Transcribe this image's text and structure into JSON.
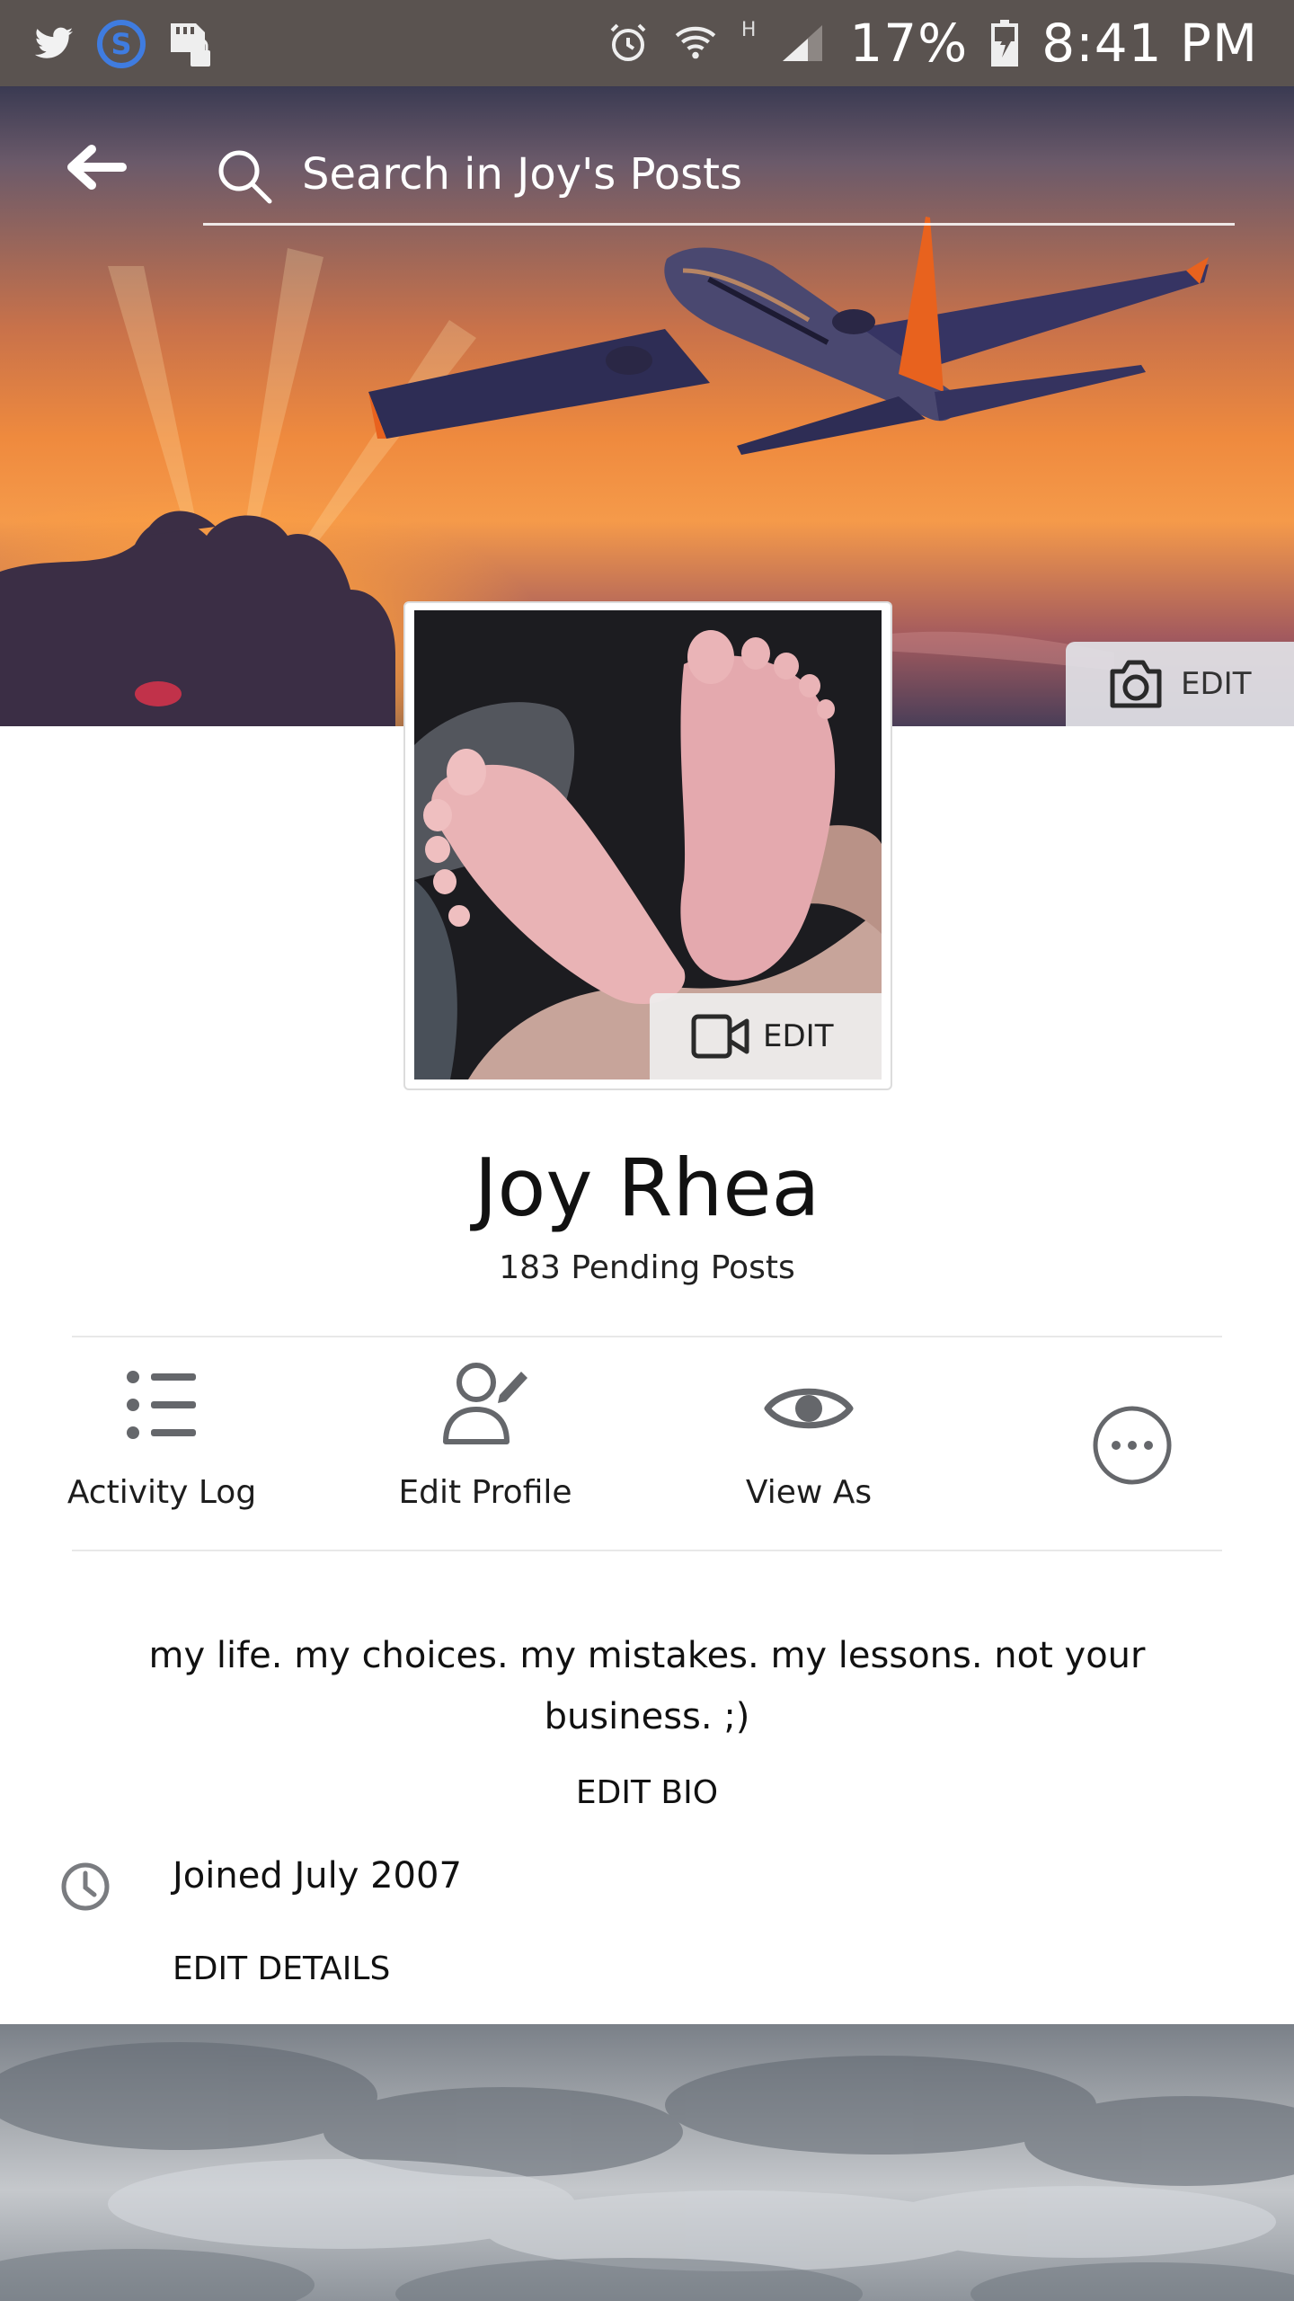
{
  "status_bar": {
    "battery": "17%",
    "time": "8:41 PM",
    "network_type": "H",
    "icons": [
      "twitter-icon",
      "s-app-icon",
      "sd-card-lock-icon",
      "alarm-icon",
      "wifi-icon",
      "signal-icon",
      "battery-charging-icon"
    ]
  },
  "header": {
    "search_placeholder": "Search in Joy's Posts",
    "back_icon": "back-arrow-icon",
    "search_icon": "search-icon"
  },
  "cover": {
    "edit_label": "EDIT",
    "edit_icon": "camera-icon"
  },
  "profile_picture": {
    "edit_label": "EDIT",
    "edit_icon": "video-camera-icon"
  },
  "profile": {
    "name": "Joy Rhea",
    "pending_posts": "183 Pending Posts"
  },
  "actions": [
    {
      "label": "Activity Log",
      "icon": "list-icon"
    },
    {
      "label": "Edit Profile",
      "icon": "person-edit-icon"
    },
    {
      "label": "View As",
      "icon": "eye-icon"
    },
    {
      "label": "",
      "icon": "more-icon"
    }
  ],
  "bio": {
    "text": "my life. my choices. my mistakes. my lessons. not your business. ;)",
    "edit_label": "EDIT BIO"
  },
  "details": {
    "joined": "Joined July 2007",
    "joined_icon": "clock-icon",
    "edit_label": "EDIT DETAILS"
  },
  "colors": {
    "status_bar": "#5a5350",
    "icon_gray": "#65676b",
    "divider": "#e8e8e8"
  }
}
